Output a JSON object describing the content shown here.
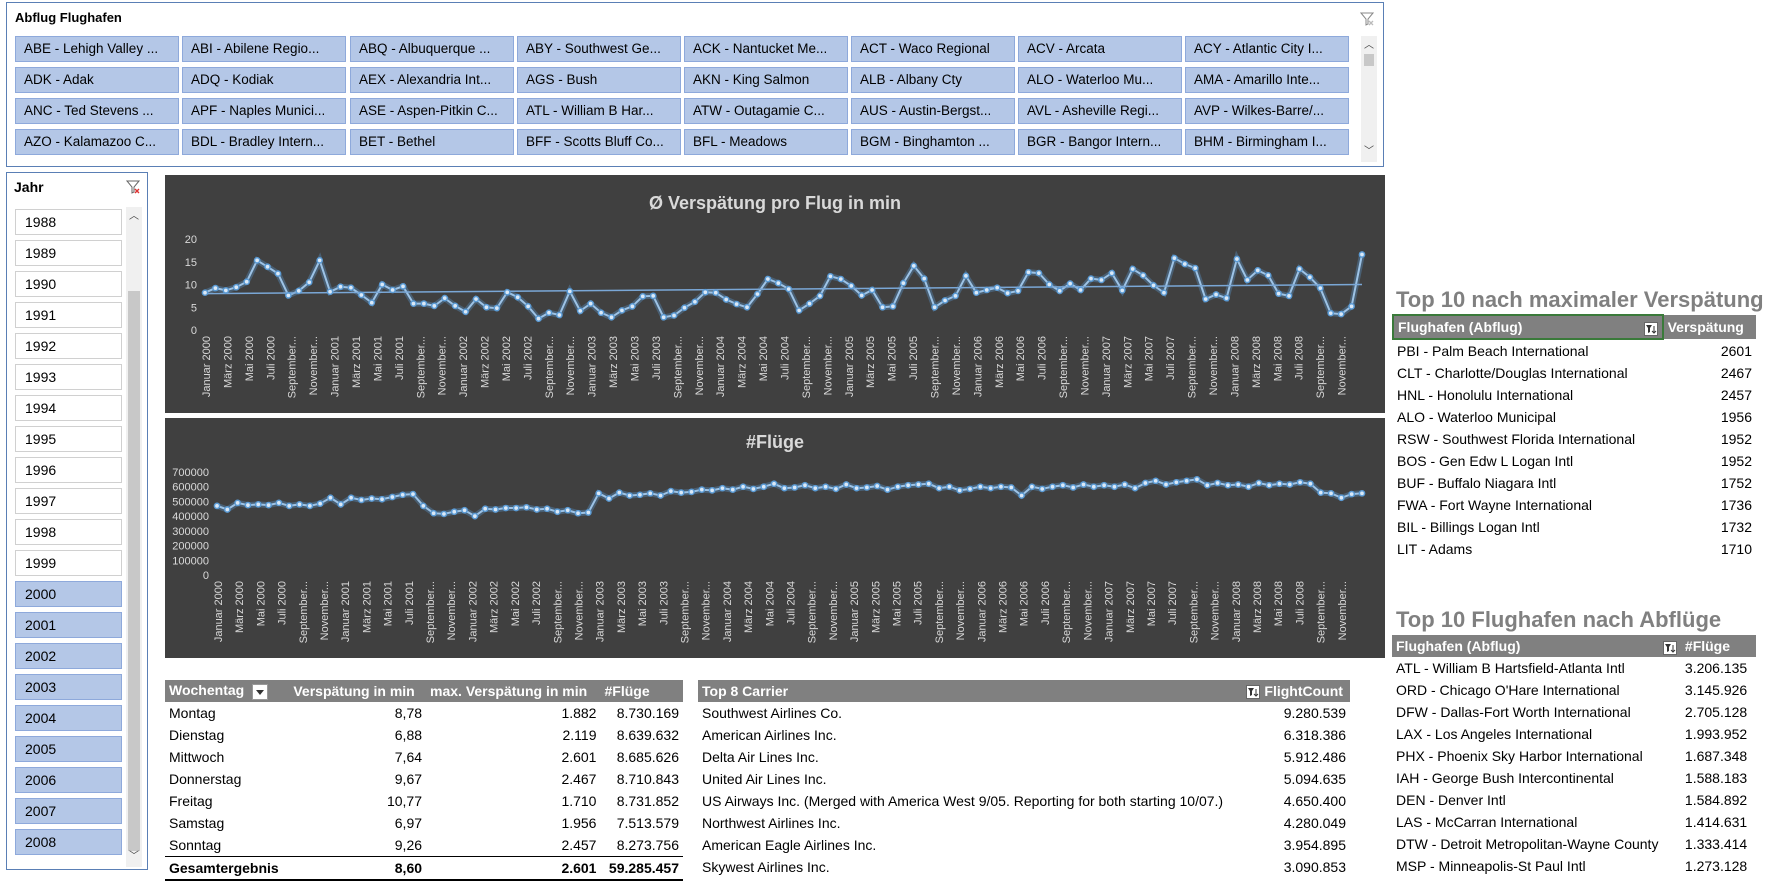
{
  "airport_slicer": {
    "title": "Abflug Flughafen",
    "items": [
      [
        "ABE - Lehigh Valley ...",
        "ABI - Abilene Regio...",
        "ABQ - Albuquerque ...",
        "ABY - Southwest Ge...",
        "ACK - Nantucket Me...",
        "ACT - Waco Regional",
        "ACV - Arcata",
        "ACY - Atlantic City I..."
      ],
      [
        "ADK - Adak",
        "ADQ - Kodiak",
        "AEX - Alexandria Int...",
        "AGS - Bush",
        "AKN - King Salmon",
        "ALB - Albany Cty",
        "ALO - Waterloo Mu...",
        "AMA - Amarillo Inte..."
      ],
      [
        "ANC - Ted Stevens ...",
        "APF - Naples Munici...",
        "ASE - Aspen-Pitkin C...",
        "ATL - William B Har...",
        "ATW - Outagamie C...",
        "AUS - Austin-Bergst...",
        "AVL - Asheville Regi...",
        "AVP - Wilkes-Barre/..."
      ],
      [
        "AZO - Kalamazoo C...",
        "BDL - Bradley Intern...",
        "BET - Bethel",
        "BFF - Scotts Bluff Co...",
        "BFL - Meadows",
        "BGM - Binghamton ...",
        "BGR - Bangor Intern...",
        "BHM - Birmingham I..."
      ]
    ]
  },
  "year_slicer": {
    "title": "Jahr",
    "years": [
      {
        "label": "1988",
        "selected": false
      },
      {
        "label": "1989",
        "selected": false
      },
      {
        "label": "1990",
        "selected": false
      },
      {
        "label": "1991",
        "selected": false
      },
      {
        "label": "1992",
        "selected": false
      },
      {
        "label": "1993",
        "selected": false
      },
      {
        "label": "1994",
        "selected": false
      },
      {
        "label": "1995",
        "selected": false
      },
      {
        "label": "1996",
        "selected": false
      },
      {
        "label": "1997",
        "selected": false
      },
      {
        "label": "1998",
        "selected": false
      },
      {
        "label": "1999",
        "selected": false
      },
      {
        "label": "2000",
        "selected": true
      },
      {
        "label": "2001",
        "selected": true
      },
      {
        "label": "2002",
        "selected": true
      },
      {
        "label": "2003",
        "selected": true
      },
      {
        "label": "2004",
        "selected": true
      },
      {
        "label": "2005",
        "selected": true
      },
      {
        "label": "2006",
        "selected": true
      },
      {
        "label": "2007",
        "selected": true
      },
      {
        "label": "2008",
        "selected": true
      }
    ]
  },
  "chart_data": [
    {
      "type": "line",
      "title": "Ø Verspätung pro Flug in min",
      "ylim": [
        0,
        20
      ],
      "yticks": [
        "0",
        "5",
        "10",
        "15",
        "20"
      ],
      "trendline": [
        8.0,
        10.0
      ],
      "x_labels": [
        "Januar 2000",
        "März 2000",
        "Mai 2000",
        "Juli 2000",
        "September...",
        "November...",
        "Januar 2001",
        "März 2001",
        "Mai 2001",
        "Juli 2001",
        "September...",
        "November...",
        "Januar 2002",
        "März 2002",
        "Mai 2002",
        "Juli 2002",
        "September...",
        "November...",
        "Januar 2003",
        "März 2003",
        "Mai 2003",
        "Juli 2003",
        "September...",
        "November...",
        "Januar 2004",
        "März 2004",
        "Mai 2004",
        "Juli 2004",
        "September...",
        "November...",
        "Januar 2005",
        "März 2005",
        "Mai 2005",
        "Juli 2005",
        "September...",
        "November...",
        "Januar 2006",
        "März 2006",
        "Mai 2006",
        "Juli 2006",
        "September...",
        "November...",
        "Januar 2007",
        "März 2007",
        "Mai 2007",
        "Juli 2007",
        "September...",
        "November...",
        "Januar 2008",
        "März 2008",
        "Mai 2008",
        "Juli 2008",
        "September...",
        "November..."
      ],
      "values": [
        8.2,
        9.2,
        8.7,
        9.4,
        10.6,
        15.3,
        13.9,
        12.4,
        7.6,
        8.6,
        10.5,
        15.3,
        8.4,
        9.5,
        9.3,
        7.7,
        6.0,
        10.0,
        8.8,
        9.6,
        5.8,
        5.8,
        5.3,
        7.0,
        5.3,
        4.0,
        6.8,
        5.0,
        4.8,
        8.3,
        7.2,
        5.2,
        2.5,
        3.8,
        3.3,
        8.5,
        4.2,
        5.8,
        3.8,
        2.8,
        4.3,
        5.2,
        7.4,
        7.5,
        2.8,
        3.2,
        4.9,
        6.2,
        8.3,
        8.2,
        6.7,
        5.7,
        5.0,
        7.9,
        11.2,
        10.3,
        9.0,
        4.3,
        5.8,
        7.5,
        11.8,
        11.2,
        9.7,
        7.6,
        8.8,
        5.0,
        5.2,
        10.3,
        14.1,
        11.3,
        5.0,
        6.5,
        7.5,
        11.9,
        8.2,
        8.8,
        9.3,
        8.1,
        8.6,
        12.7,
        12.5,
        10.0,
        8.6,
        10.2,
        8.8,
        11.3,
        11.0,
        12.5,
        8.7,
        13.4,
        12.0,
        9.8,
        8.2,
        15.8,
        14.5,
        13.6,
        6.8,
        7.8,
        7.0,
        15.6,
        11.0,
        13.1,
        12.0,
        8.0,
        7.5,
        13.4,
        11.6,
        9.2,
        3.7,
        3.5,
        5.2,
        16.6
      ]
    },
    {
      "type": "line",
      "title": "#Flüge",
      "ylim": [
        0,
        700000
      ],
      "yticks": [
        "0",
        "100000",
        "200000",
        "300000",
        "400000",
        "500000",
        "600000",
        "700000"
      ],
      "x_labels": [
        "Januar 2000",
        "März 2000",
        "Mai 2000",
        "Juli 2000",
        "September...",
        "November...",
        "Januar 2001",
        "März 2001",
        "Mai 2001",
        "Juli 2001",
        "September...",
        "November...",
        "Januar 2002",
        "März 2002",
        "Mai 2002",
        "Juli 2002",
        "September...",
        "November...",
        "Januar 2003",
        "März 2003",
        "Mai 2003",
        "Juli 2003",
        "September...",
        "November...",
        "Januar 2004",
        "März 2004",
        "Mai 2004",
        "Juli 2004",
        "September...",
        "November...",
        "Januar 2005",
        "März 2005",
        "Mai 2005",
        "Juli 2005",
        "September...",
        "November...",
        "Januar 2006",
        "März 2006",
        "Mai 2006",
        "Juli 2006",
        "September...",
        "November...",
        "Januar 2007",
        "März 2007",
        "Mai 2007",
        "Juli 2007",
        "September...",
        "November...",
        "Januar 2008",
        "März 2008",
        "Mai 2008",
        "Juli 2008",
        "September...",
        "November..."
      ],
      "values": [
        470000,
        445000,
        490000,
        475000,
        480000,
        475000,
        490000,
        470000,
        480000,
        470000,
        485000,
        525000,
        480000,
        525000,
        510000,
        520000,
        515000,
        530000,
        545000,
        550000,
        470000,
        420000,
        415000,
        430000,
        440000,
        400000,
        450000,
        445000,
        455000,
        455000,
        460000,
        445000,
        450000,
        430000,
        440000,
        420000,
        425000,
        555000,
        520000,
        560000,
        540000,
        545000,
        555000,
        540000,
        570000,
        560000,
        565000,
        580000,
        575000,
        590000,
        580000,
        600000,
        585000,
        600000,
        620000,
        590000,
        595000,
        610000,
        590000,
        600000,
        585000,
        615000,
        590000,
        595000,
        605000,
        580000,
        600000,
        610000,
        615000,
        620000,
        590000,
        600000,
        575000,
        585000,
        600000,
        590000,
        600000,
        595000,
        540000,
        600000,
        585000,
        600000,
        610000,
        595000,
        615000,
        600000,
        610000,
        600000,
        615000,
        590000,
        625000,
        640000,
        615000,
        630000,
        640000,
        650000,
        610000,
        625000,
        610000,
        615000,
        600000,
        625000,
        610000,
        620000,
        615000,
        630000,
        620000,
        560000,
        555000,
        525000,
        550000,
        555000
      ]
    }
  ],
  "weekday_table": {
    "headers": [
      "Wochentag",
      "Verspätung in min",
      "max. Verspätung in min",
      "#Flüge"
    ],
    "rows": [
      [
        "Montag",
        "8,78",
        "1.882",
        "8.730.169"
      ],
      [
        "Dienstag",
        "6,88",
        "2.119",
        "8.639.632"
      ],
      [
        "Mittwoch",
        "7,64",
        "2.601",
        "8.685.626"
      ],
      [
        "Donnerstag",
        "9,67",
        "2.467",
        "8.710.843"
      ],
      [
        "Freitag",
        "10,77",
        "1.710",
        "8.731.852"
      ],
      [
        "Samstag",
        "6,97",
        "1.956",
        "7.513.579"
      ],
      [
        "Sonntag",
        "9,26",
        "2.457",
        "8.273.756"
      ]
    ],
    "total": [
      "Gesamtergebnis",
      "8,60",
      "2.601",
      "59.285.457"
    ]
  },
  "carrier_table": {
    "headers": [
      "Top 8 Carrier",
      "FlightCount"
    ],
    "rows": [
      [
        "Southwest Airlines Co.",
        "9.280.539"
      ],
      [
        "American Airlines Inc.",
        "6.318.386"
      ],
      [
        "Delta Air Lines Inc.",
        "5.912.486"
      ],
      [
        "United Air Lines Inc.",
        "5.094.635"
      ],
      [
        "US Airways Inc. (Merged with America West 9/05. Reporting for both starting 10/07.)",
        "4.650.400"
      ],
      [
        "Northwest Airlines Inc.",
        "4.280.049"
      ],
      [
        "American Eagle Airlines Inc.",
        "3.954.895"
      ],
      [
        "Skywest Airlines Inc.",
        "3.090.853"
      ]
    ]
  },
  "delay_top10": {
    "title": "Top 10 nach maximaler Verspätung",
    "headers": [
      "Flughafen (Abflug)",
      "Verspätung"
    ],
    "rows": [
      [
        "PBI - Palm Beach International",
        "2601"
      ],
      [
        "CLT - Charlotte/Douglas International",
        "2467"
      ],
      [
        "HNL - Honolulu International",
        "2457"
      ],
      [
        "ALO - Waterloo Municipal",
        "1956"
      ],
      [
        "RSW - Southwest Florida International",
        "1952"
      ],
      [
        "BOS - Gen Edw L Logan Intl",
        "1952"
      ],
      [
        "BUF - Buffalo Niagara Intl",
        "1752"
      ],
      [
        "FWA - Fort Wayne International",
        "1736"
      ],
      [
        "BIL - Billings Logan Intl",
        "1732"
      ],
      [
        "LIT - Adams",
        "1710"
      ]
    ]
  },
  "departures_top10": {
    "title": "Top 10 Flughafen nach Abflüge",
    "headers": [
      "Flughafen (Abflug)",
      "#Flüge"
    ],
    "rows": [
      [
        "ATL - William B Hartsfield-Atlanta Intl",
        "3.206.135"
      ],
      [
        "ORD - Chicago O'Hare International",
        "3.145.926"
      ],
      [
        "DFW - Dallas-Fort Worth International",
        "2.705.128"
      ],
      [
        "LAX - Los Angeles International",
        "1.993.952"
      ],
      [
        "PHX - Phoenix Sky Harbor International",
        "1.687.348"
      ],
      [
        "IAH - George Bush Intercontinental",
        "1.588.183"
      ],
      [
        "DEN - Denver Intl",
        "1.584.892"
      ],
      [
        "LAS - McCarran International",
        "1.414.631"
      ],
      [
        "DTW - Detroit Metropolitan-Wayne County",
        "1.333.414"
      ],
      [
        "MSP - Minneapolis-St Paul Intl",
        "1.273.128"
      ]
    ]
  },
  "colors": {
    "slicer_selected": "#b4c7e7",
    "chart_bg": "#404040",
    "line": "#5b9bd5",
    "header_gray": "#808080"
  }
}
